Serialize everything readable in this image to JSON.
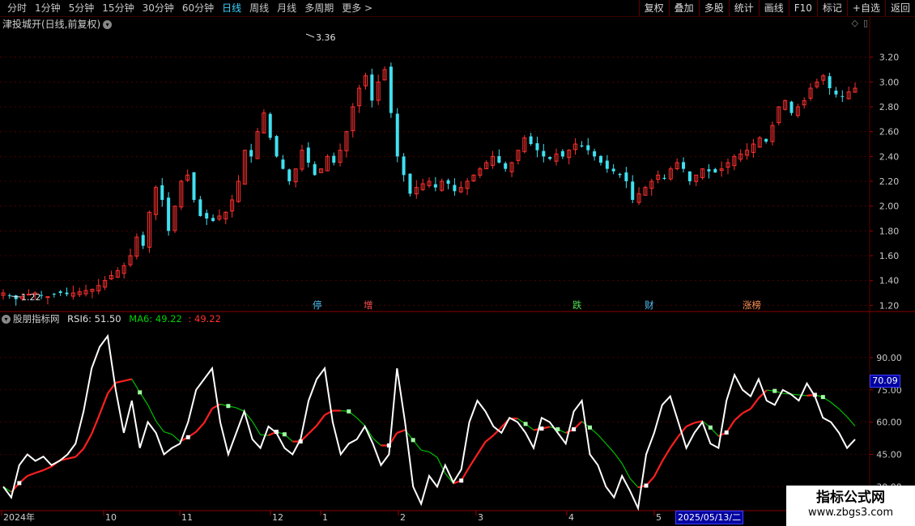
{
  "toolbar": {
    "periods": [
      "分时",
      "1分钟",
      "5分钟",
      "15分钟",
      "30分钟",
      "60分钟",
      "日线",
      "周线",
      "月线",
      "多周期",
      "更多 >"
    ],
    "active_period": "日线",
    "buttons": [
      "复权",
      "叠加",
      "多股",
      "统计",
      "画线",
      "F10",
      "标记",
      "+自选",
      "返回"
    ]
  },
  "stock_title": "津投城开(日线,前复权)",
  "price_axis": [
    "3.20",
    "3.00",
    "2.80",
    "2.60",
    "2.40",
    "2.20",
    "2.00",
    "1.80",
    "1.60",
    "1.40",
    "1.20"
  ],
  "rsi_axis": [
    "90.00",
    "75.00",
    "60.00",
    "45.00",
    "30.00"
  ],
  "annotations": {
    "high_label": "3.36",
    "low_label": "1.22"
  },
  "events": [
    {
      "label": "停",
      "color": "#4fc3f7"
    },
    {
      "label": "增",
      "color": "#ff5050"
    },
    {
      "label": "跌",
      "color": "#50e050"
    },
    {
      "label": "财",
      "color": "#4fc3f7"
    },
    {
      "label": "涨榜",
      "color": "#ff9050"
    }
  ],
  "indicator": {
    "name": "股朋指标网",
    "rsi_label": "RSI6: 51.50",
    "ma_label": "MA6: 49.22",
    "extra_label": ": 49.22",
    "current_badge": "70.09"
  },
  "time_axis": [
    "2024年",
    "10",
    "11",
    "12",
    "1",
    "2",
    "3",
    "4",
    "5",
    "6"
  ],
  "date_badge": "2025/05/13/二",
  "watermark": {
    "title": "指标公式网",
    "url": "www.zbgs3.com"
  },
  "colors": {
    "up": "#ff3030",
    "down": "#40e0f0",
    "rsi": "#ffffff",
    "ma": "#00c000",
    "ma_up": "#ff2020",
    "grid": "#5a0000"
  },
  "chart_data": {
    "type": "candlestick",
    "ylim": [
      1.15,
      3.4
    ],
    "closes": [
      1.3,
      1.28,
      1.25,
      1.27,
      1.29,
      1.3,
      1.28,
      1.27,
      1.29,
      1.3,
      1.29,
      1.3,
      1.31,
      1.32,
      1.33,
      1.36,
      1.4,
      1.44,
      1.48,
      1.52,
      1.6,
      1.75,
      1.68,
      1.95,
      2.15,
      2.05,
      1.8,
      2.0,
      2.2,
      2.25,
      2.05,
      1.92,
      1.9,
      1.88,
      1.92,
      1.95,
      2.05,
      2.2,
      2.45,
      2.4,
      2.6,
      2.75,
      2.55,
      2.4,
      2.3,
      2.2,
      2.3,
      2.45,
      2.35,
      2.25,
      2.3,
      2.4,
      2.35,
      2.45,
      2.6,
      2.8,
      2.95,
      3.05,
      2.85,
      3.0,
      3.1,
      2.75,
      2.4,
      2.25,
      2.1,
      2.15,
      2.18,
      2.2,
      2.15,
      2.2,
      2.18,
      2.12,
      2.15,
      2.2,
      2.25,
      2.3,
      2.35,
      2.4,
      2.35,
      2.3,
      2.35,
      2.45,
      2.55,
      2.5,
      2.45,
      2.4,
      2.38,
      2.42,
      2.4,
      2.45,
      2.5,
      2.48,
      2.45,
      2.4,
      2.35,
      2.3,
      2.28,
      2.25,
      2.2,
      2.05,
      2.1,
      2.15,
      2.2,
      2.25,
      2.22,
      2.3,
      2.35,
      2.3,
      2.2,
      2.25,
      2.3,
      2.28,
      2.27,
      2.3,
      2.35,
      2.4,
      2.42,
      2.45,
      2.5,
      2.55,
      2.52,
      2.65,
      2.8,
      2.85,
      2.75,
      2.8,
      2.85,
      2.95,
      3.0,
      3.05,
      2.95,
      2.9,
      2.88,
      2.92,
      2.95
    ],
    "rsi6": [
      30,
      25,
      40,
      45,
      42,
      44,
      40,
      42,
      45,
      50,
      65,
      85,
      95,
      100,
      75,
      55,
      70,
      48,
      60,
      55,
      45,
      48,
      50,
      60,
      75,
      80,
      85,
      60,
      45,
      55,
      65,
      52,
      48,
      58,
      55,
      48,
      45,
      52,
      70,
      80,
      85,
      60,
      45,
      50,
      52,
      58,
      50,
      40,
      45,
      85,
      60,
      30,
      22,
      35,
      30,
      40,
      32,
      38,
      60,
      70,
      65,
      58,
      55,
      62,
      60,
      55,
      48,
      62,
      60,
      55,
      50,
      65,
      70,
      45,
      40,
      30,
      25,
      35,
      28,
      20,
      45,
      55,
      68,
      72,
      60,
      48,
      55,
      60,
      50,
      48,
      70,
      82,
      75,
      72,
      80,
      70,
      68,
      75,
      73,
      70,
      78,
      72,
      62,
      60,
      55,
      48,
      52
    ]
  }
}
